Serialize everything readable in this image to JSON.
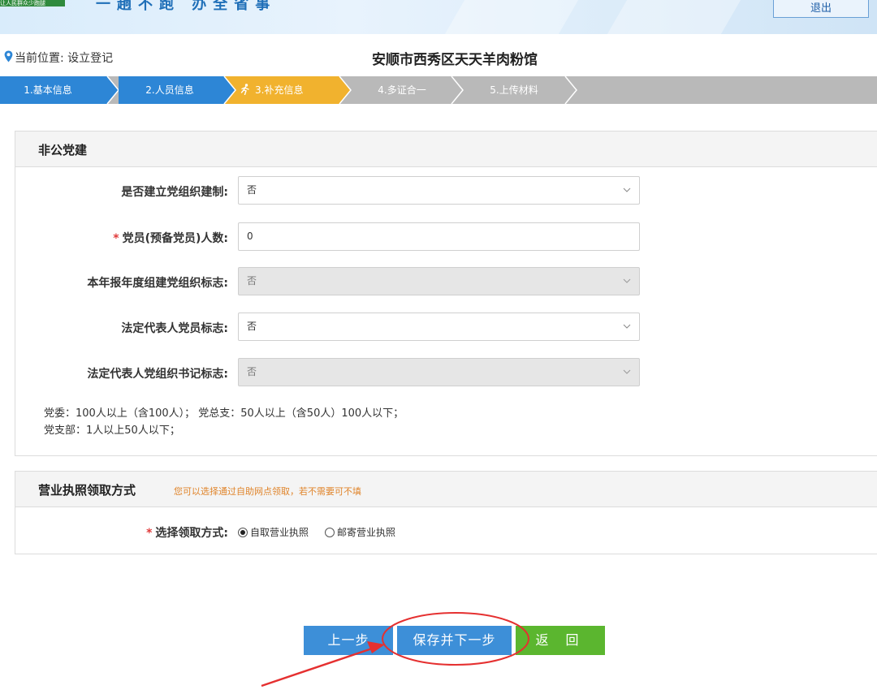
{
  "header": {
    "badge_text": "让人民群众少跑腿",
    "slogan": "一趟不跑  办全省事",
    "logout_label": "退出"
  },
  "breadcrumb": {
    "location_text": "当前位置: 设立登记",
    "company_name": "安顺市西秀区天天羊肉粉馆"
  },
  "steps": [
    {
      "label": "1.基本信息",
      "state": "done"
    },
    {
      "label": "2.人员信息",
      "state": "done"
    },
    {
      "label": "3.补充信息",
      "state": "active"
    },
    {
      "label": "4.多证合一",
      "state": "todo"
    },
    {
      "label": "5.上传材料",
      "state": "todo"
    }
  ],
  "party_section": {
    "title": "非公党建",
    "fields": [
      {
        "label": "是否建立党组织建制:",
        "value": "否",
        "type": "select",
        "required": false,
        "disabled": false
      },
      {
        "label": "党员(预备党员)人数:",
        "value": "0",
        "type": "text",
        "required": true,
        "disabled": false
      },
      {
        "label": "本年报年度组建党组织标志:",
        "value": "否",
        "type": "select",
        "required": false,
        "disabled": true
      },
      {
        "label": "法定代表人党员标志:",
        "value": "否",
        "type": "select",
        "required": false,
        "disabled": false
      },
      {
        "label": "法定代表人党组织书记标志:",
        "value": "否",
        "type": "select",
        "required": false,
        "disabled": true
      }
    ],
    "hint_line1": "党委：100人以上（含100人）；   党总支：50人以上（含50人）100人以下；",
    "hint_line2": "党支部：1人以上50人以下；"
  },
  "license_section": {
    "title": "营业执照领取方式",
    "note": "您可以选择通过自助网点领取，若不需要可不填",
    "required_mark": "*",
    "label": "选择领取方式:",
    "options": [
      {
        "label": "自取营业执照",
        "selected": true
      },
      {
        "label": "邮寄营业执照",
        "selected": false
      }
    ]
  },
  "buttons": {
    "prev": "上一步",
    "save_next": "保存并下一步",
    "back": "返 回"
  },
  "colors": {
    "step_done": "#2d86d6",
    "step_active": "#f1b22e",
    "step_todo": "#b9b9b9",
    "btn_primary": "#3d8fd8",
    "btn_back": "#5bb62f",
    "required": "#e03a3a",
    "note": "#e0842a",
    "annotation": "#e53030"
  },
  "icons": {
    "location": "location-pin-icon",
    "active_step": "running-person-icon",
    "select_caret": "chevron-down-icon"
  }
}
